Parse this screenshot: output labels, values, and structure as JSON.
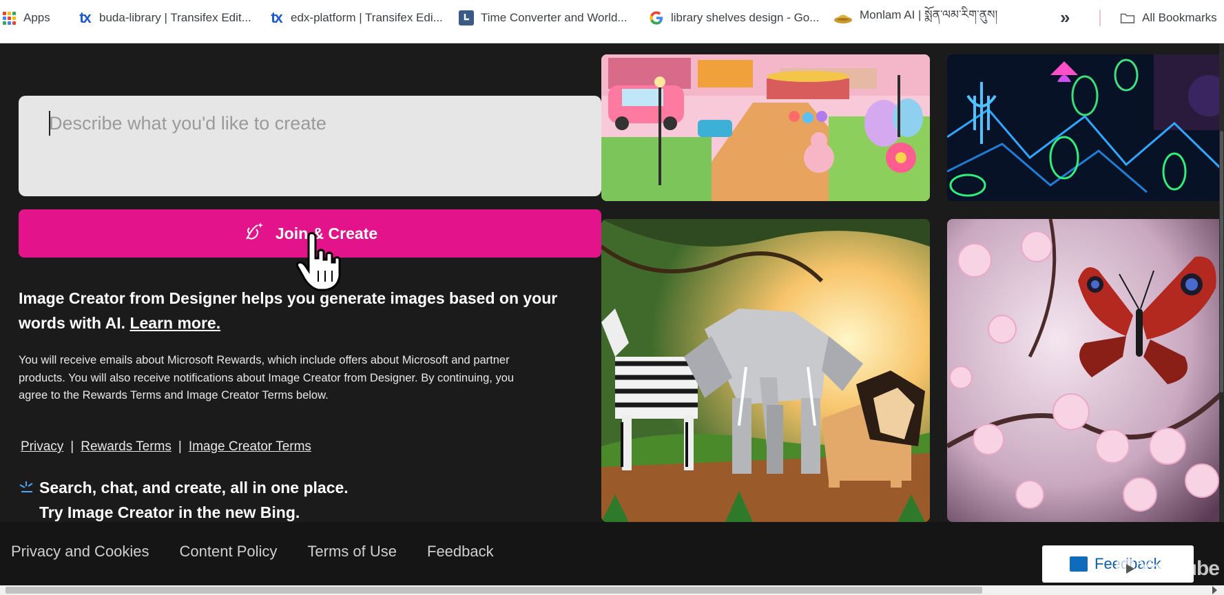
{
  "bookmarks": {
    "items": [
      {
        "label": "Apps",
        "icon": "apps-grid-icon"
      },
      {
        "label": "buda-library | Transifex Edit...",
        "icon": "transifex-icon"
      },
      {
        "label": "edx-platform | Transifex Edi...",
        "icon": "transifex-icon"
      },
      {
        "label": "Time Converter and World...",
        "icon": "clock-icon"
      },
      {
        "label": "library shelves design - Go...",
        "icon": "google-icon"
      },
      {
        "label": "Monlam AI | སྨོན་ལམ་རིག་ནུས།",
        "icon": "monlam-icon"
      }
    ],
    "overflow_label": "»",
    "all_bookmarks_label": "All Bookmarks"
  },
  "creator": {
    "prompt_placeholder": "Describe what you'd like to create",
    "join_button_label": "Join & Create",
    "headline": "Image Creator from Designer helps you generate images based on your words with AI.",
    "learn_more_label": "Learn more.",
    "disclaimer": "You will receive emails about Microsoft Rewards, which include offers about Microsoft and partner products. You will also receive notifications about Image Creator from Designer. By continuing, you agree to the Rewards Terms and Image Creator Terms below.",
    "terms_links": [
      "Privacy",
      "Rewards Terms",
      "Image Creator Terms"
    ],
    "terms_separator": "|",
    "promo_line1": "Search, chat, and create, all in one place.",
    "promo_line2": "Try Image Creator in the new Bing."
  },
  "gallery": {
    "images": [
      {
        "subject": "easter-park-scene"
      },
      {
        "subject": "neon-circuit-plants"
      },
      {
        "subject": "origami-safari-animals"
      },
      {
        "subject": "butterfly-cherry-blossom"
      }
    ]
  },
  "footer": {
    "links": [
      "Privacy and Cookies",
      "Content Policy",
      "Terms of Use",
      "Feedback"
    ],
    "feedback_button_label": "Feedback"
  },
  "overlay": {
    "watermark": "YouTube"
  },
  "colors": {
    "accent_pink": "#e3138c",
    "page_bg": "#1b1b1b",
    "footer_bg": "#151515"
  }
}
